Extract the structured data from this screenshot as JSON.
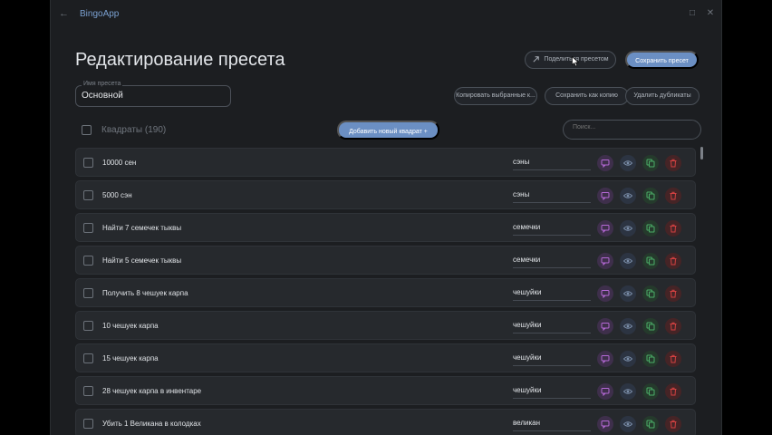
{
  "titlebar": {
    "app_name": "BingoApp"
  },
  "page": {
    "title": "Редактирование пресета"
  },
  "actions": {
    "share_label": "Поделиться пресетом",
    "save_label": "Сохранить пресет",
    "copy_selected_label": "Копировать выбранные к...",
    "import_as_copy_label": "Сохранить как копию",
    "delete_duplicates_label": "Удалить дубликаты",
    "add_square_label": "Добавить новый квадрат +"
  },
  "preset_name": {
    "legend": "Имя пресета",
    "value": "Основной"
  },
  "squares": {
    "label": "Квадраты (190)"
  },
  "search": {
    "placeholder": "Поиск..."
  },
  "rows": [
    {
      "text": "10000 сен",
      "category": "сэны"
    },
    {
      "text": "5000 сэн",
      "category": "сэны"
    },
    {
      "text": "Найти 7 семечек тыквы",
      "category": "семечки"
    },
    {
      "text": "Найти 5 семечек тыквы",
      "category": "семечки"
    },
    {
      "text": "Получить 8 чешуек карпа",
      "category": "чешуйки"
    },
    {
      "text": "10 чешуек карпа",
      "category": "чешуйки"
    },
    {
      "text": "15 чешуек карпа",
      "category": "чешуйки"
    },
    {
      "text": "28 чешуек карпа в инвентаре",
      "category": "чешуйки"
    },
    {
      "text": "Убить 1 Великана в колодках",
      "category": "великан"
    }
  ],
  "colors": {
    "accent": "#6b8fc3",
    "comment": "#b569d6",
    "view": "#7a8da8",
    "copy": "#4caf68",
    "delete": "#d24141"
  },
  "icons": {
    "comment": "comment-icon",
    "view": "eye-icon",
    "copy": "copy-icon",
    "delete": "trash-icon"
  }
}
